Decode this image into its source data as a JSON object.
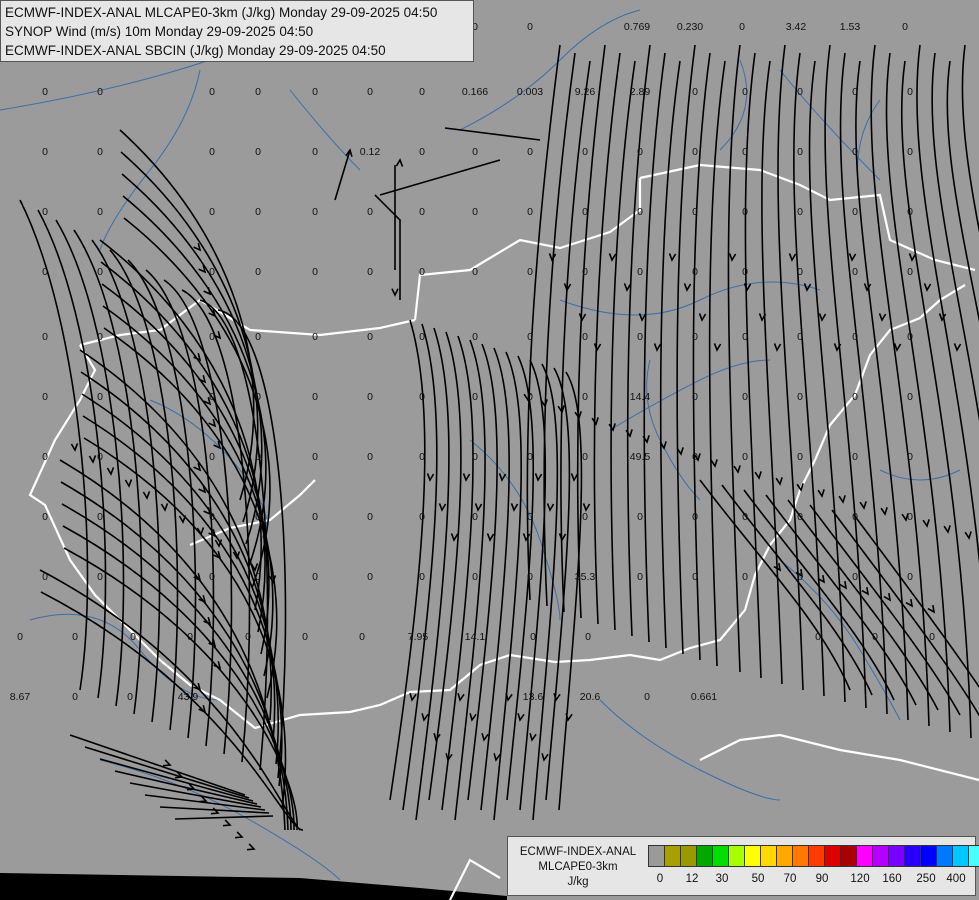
{
  "titles": [
    "ECMWF-INDEX-ANAL MLCAPE0-3km (J/kg) Monday 29-09-2025 04:50",
    "SYNOP Wind (m/s) 10m Monday 29-09-2025 04:50",
    "ECMWF-INDEX-ANAL SBCIN (J/kg) Monday 29-09-2025 04:50"
  ],
  "legend": {
    "title_lines": [
      "ECMWF-INDEX-ANAL",
      "MLCAPE0-3km",
      "J/kg"
    ],
    "colors": [
      "#9a9a9a",
      "#a8a000",
      "#9a9a00",
      "#00a800",
      "#00dd00",
      "#a8ff00",
      "#ffff00",
      "#ffd800",
      "#ffa800",
      "#ff7800",
      "#ff3c00",
      "#dd0000",
      "#a80000",
      "#ff00ff",
      "#b400ff",
      "#7800ff",
      "#2800ff",
      "#0000ff",
      "#0078ff",
      "#00c8ff",
      "#46ffff",
      "#a8ffff",
      "#ffffff"
    ],
    "ticks": [
      "0",
      "12",
      "30",
      "50",
      "70",
      "90",
      "120",
      "160",
      "250",
      "400"
    ]
  },
  "map_values": [
    "0",
    "0",
    "0",
    "0",
    "0.769",
    "0.230",
    "0",
    "3.42",
    "1.53",
    "0",
    "0",
    "0",
    "0",
    "0",
    "0",
    "0",
    "0",
    "0.166",
    "0.003",
    "9.26",
    "2.89",
    "0",
    "0",
    "0",
    "0",
    "0",
    "0",
    "0",
    "0",
    "0",
    "0",
    "0.12",
    "0",
    "0",
    "0",
    "0",
    "0",
    "0",
    "0",
    "0",
    "0",
    "0",
    "0",
    "0",
    "0",
    "0",
    "0",
    "0",
    "0",
    "0",
    "0",
    "0",
    "0",
    "0",
    "0",
    "0",
    "0",
    "0",
    "0",
    "0",
    "0",
    "0",
    "0",
    "0",
    "0",
    "0",
    "0",
    "0",
    "0",
    "0",
    "0",
    "0",
    "0",
    "0",
    "0",
    "0",
    "0",
    "0",
    "0",
    "0",
    "0",
    "0",
    "0",
    "0",
    "0",
    "0",
    "0",
    "0",
    "0",
    "0",
    "0",
    "0",
    "0",
    "0",
    "0",
    "0",
    "0",
    "0",
    "0",
    "0",
    "14.4",
    "0",
    "0",
    "0",
    "0",
    "0",
    "0",
    "0",
    "0",
    "0",
    "0",
    "0",
    "0",
    "0",
    "0",
    "0",
    "49.5",
    "0",
    "0",
    "0",
    "0",
    "0",
    "0",
    "0",
    "0",
    "0",
    "0",
    "0",
    "0",
    "0",
    "0",
    "0",
    "0",
    "0",
    "0",
    "0",
    "0",
    "0",
    "0",
    "0",
    "0",
    "0",
    "0",
    "0",
    "0",
    "0",
    "0",
    "35.3",
    "0",
    "0",
    "0",
    "0",
    "0",
    "0",
    "0",
    "0",
    "0",
    "0",
    "0",
    "0",
    "0",
    "7.95",
    "14.1",
    "0",
    "0",
    "0",
    "0",
    "0",
    "8.67",
    "0",
    "0",
    "43.9",
    "13.6",
    "20.6",
    "0",
    "0.661"
  ],
  "colors": {
    "background": "#9b9b9b",
    "border": "#ffffff",
    "river": "#3b6fa8",
    "streamline": "#000000"
  }
}
